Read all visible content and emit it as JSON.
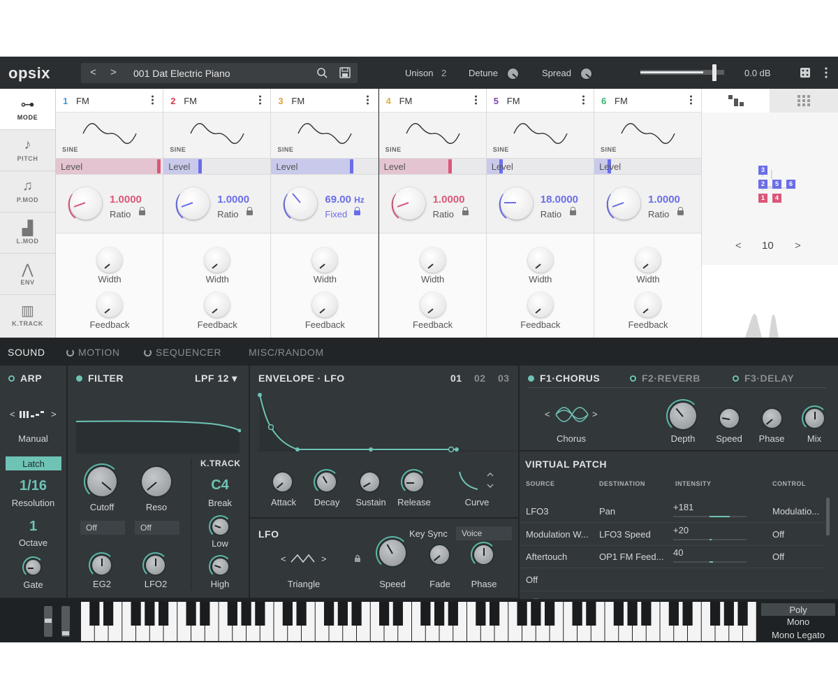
{
  "app": {
    "logo": "opsix",
    "preset_name": "001 Dat Electric Piano",
    "unison_label": "Unison",
    "unison_value": "2",
    "detune_label": "Detune",
    "spread_label": "Spread",
    "volume": "0.0 dB",
    "prev": "<",
    "next": ">"
  },
  "modes": [
    {
      "label": "MODE",
      "icon": "mode-icon"
    },
    {
      "label": "PITCH",
      "icon": "note-icon"
    },
    {
      "label": "P.MOD",
      "icon": "pmod-icon"
    },
    {
      "label": "L.MOD",
      "icon": "lmod-icon"
    },
    {
      "label": "ENV",
      "icon": "env-icon"
    },
    {
      "label": "K.TRACK",
      "icon": "piano-icon"
    }
  ],
  "operators": [
    {
      "num": "1",
      "type": "FM",
      "color": "#3e9bd9",
      "wave": "SINE",
      "level_label": "Level",
      "level": 0.98,
      "level_color": "#d9587a",
      "ratio": "1.0000",
      "ratio_label": "Ratio",
      "ratio_color": "#d9587a",
      "width_label": "Width",
      "feedback_label": "Feedback"
    },
    {
      "num": "2",
      "type": "FM",
      "color": "#d9364f",
      "wave": "SINE",
      "level_label": "Level",
      "level": 0.36,
      "level_color": "#6a6ee6",
      "ratio": "1.0000",
      "ratio_label": "Ratio",
      "ratio_color": "#6a6ee6",
      "width_label": "Width",
      "feedback_label": "Feedback"
    },
    {
      "num": "3",
      "type": "FM",
      "color": "#e0a23c",
      "wave": "SINE",
      "level_label": "Level",
      "level": 0.77,
      "level_color": "#6a6ee6",
      "ratio": "69.00",
      "ratio_unit": "Hz",
      "ratio_label": "Fixed",
      "ratio_color": "#6a6ee6",
      "width_label": "Width",
      "feedback_label": "Feedback"
    },
    {
      "num": "4",
      "type": "FM",
      "color": "#e0b03c",
      "wave": "SINE",
      "level_label": "Level",
      "level": 0.68,
      "level_color": "#d9587a",
      "ratio": "1.0000",
      "ratio_label": "Ratio",
      "ratio_color": "#d9587a",
      "width_label": "Width",
      "feedback_label": "Feedback"
    },
    {
      "num": "5",
      "type": "FM",
      "color": "#7b3fb0",
      "wave": "SINE",
      "level_label": "Level",
      "level": 0.15,
      "level_color": "#6a6ee6",
      "ratio": "18.0000",
      "ratio_label": "Ratio",
      "ratio_color": "#6a6ee6",
      "width_label": "Width",
      "feedback_label": "Feedback"
    },
    {
      "num": "6",
      "type": "FM",
      "color": "#35b26e",
      "wave": "SINE",
      "level_label": "Level",
      "level": 0.16,
      "level_color": "#6a6ee6",
      "ratio": "1.0000",
      "ratio_label": "Ratio",
      "ratio_color": "#6a6ee6",
      "width_label": "Width",
      "feedback_label": "Feedback"
    }
  ],
  "algorithm": {
    "number": "10",
    "boxes": [
      "3",
      "2",
      "5",
      "6",
      "1",
      "4"
    ],
    "prev": "<",
    "next": ">"
  },
  "sections": {
    "sound": "SOUND",
    "motion": "MOTION",
    "sequencer": "SEQUENCER",
    "misc": "MISC/RANDOM"
  },
  "arp": {
    "title": "ARP",
    "pattern": "Manual",
    "latch": "Latch",
    "resolution": "1/16",
    "resolution_label": "Resolution",
    "octave": "1",
    "octave_label": "Octave",
    "gate_label": "Gate",
    "prev": "<",
    "next": ">"
  },
  "filter": {
    "title": "FILTER",
    "type": "LPF 12 ▾",
    "cutoff": "Cutoff",
    "reso": "Reso",
    "src1": "Off",
    "src2": "Off",
    "eg2": "EG2",
    "lfo2": "LFO2",
    "ktrack": "K.TRACK",
    "break_val": "C4",
    "break_label": "Break",
    "low": "Low",
    "high": "High"
  },
  "envelope": {
    "title": "ENVELOPE · LFO",
    "tabs": [
      "01",
      "02",
      "03"
    ],
    "attack": "Attack",
    "decay": "Decay",
    "sustain": "Sustain",
    "release": "Release",
    "curve": "Curve"
  },
  "lfo": {
    "title": "LFO",
    "keysync_label": "Key Sync",
    "keysync_value": "Voice",
    "wave": "Triangle",
    "speed": "Speed",
    "fade": "Fade",
    "phase": "Phase",
    "prev": "<",
    "next": ">"
  },
  "effects": {
    "tabs": [
      "F1·CHORUS",
      "F2·REVERB",
      "F3·DELAY"
    ],
    "type": "Chorus",
    "depth": "Depth",
    "speed": "Speed",
    "phase": "Phase",
    "mix": "Mix",
    "prev": "<",
    "next": ">"
  },
  "virtual_patch": {
    "title": "VIRTUAL PATCH",
    "headers": [
      "SOURCE",
      "DESTINATION",
      "INTENSITY",
      "CONTROL"
    ],
    "rows": [
      {
        "source": "LFO3",
        "destination": "Pan",
        "intensity": "+181",
        "control": "Modulatio...",
        "amount": 0.55
      },
      {
        "source": "Modulation W...",
        "destination": "LFO3 Speed",
        "intensity": "+20",
        "control": "Off",
        "amount": 0.05
      },
      {
        "source": "Aftertouch",
        "destination": "OP1 FM Feed...",
        "intensity": "40",
        "control": "Off",
        "amount": 0.1
      },
      {
        "source": "Off",
        "destination": "",
        "intensity": "",
        "control": "",
        "amount": 0
      },
      {
        "source": "Off",
        "destination": "",
        "intensity": "",
        "control": "",
        "amount": 0
      }
    ]
  },
  "voice_modes": [
    "Poly",
    "Mono",
    "Mono Legato"
  ],
  "colors": {
    "accent": "#6ec3b5",
    "bg": "#32373a",
    "topbar": "#2b2e30"
  }
}
